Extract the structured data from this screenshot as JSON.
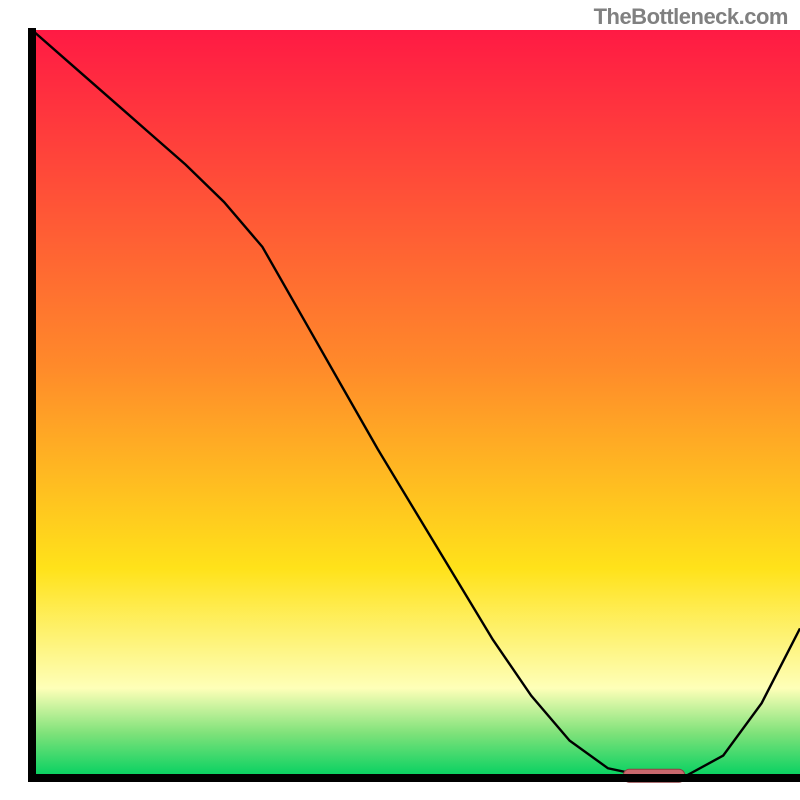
{
  "attribution": "TheBottleneck.com",
  "colors": {
    "axis": "#000000",
    "curve": "#000000",
    "marker_fill": "#c9686d",
    "marker_stroke": "#8e3f42",
    "grad_top": "#ff1a44",
    "grad_mid1": "#ff8a2a",
    "grad_mid2": "#ffe21a",
    "grad_pale": "#feffb8",
    "grad_green1": "#7fe27a",
    "grad_green2": "#00d060"
  },
  "chart_data": {
    "type": "line",
    "title": "",
    "xlabel": "",
    "ylabel": "",
    "xlim": [
      0,
      100
    ],
    "ylim": [
      0,
      100
    ],
    "x": [
      0,
      5,
      10,
      15,
      20,
      25,
      30,
      35,
      40,
      45,
      50,
      55,
      60,
      65,
      70,
      75,
      80,
      83,
      85,
      90,
      95,
      100
    ],
    "values": [
      100,
      95.5,
      91,
      86.5,
      82,
      77,
      71,
      62,
      53,
      44,
      35.5,
      27,
      18.5,
      11,
      5,
      1.3,
      0.2,
      0,
      0.2,
      3,
      10,
      20
    ],
    "marker": {
      "x_start": 77,
      "x_end": 85,
      "y": 0.3
    }
  }
}
